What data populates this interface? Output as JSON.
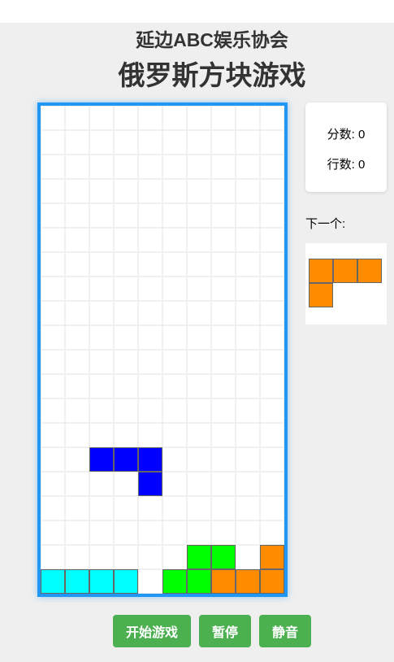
{
  "header": {
    "subtitle": "延边ABC娱乐协会",
    "title": "俄罗斯方块游戏"
  },
  "stats": {
    "score_label": "分数: 0",
    "lines_label": "行数: 0",
    "score": 0,
    "lines": 0
  },
  "next_piece": {
    "label": "下一个:",
    "type": "L",
    "color": "#ff8c00",
    "cells": [
      [
        0,
        0
      ],
      [
        1,
        0
      ],
      [
        2,
        0
      ],
      [
        0,
        1
      ]
    ]
  },
  "board": {
    "columns": 10,
    "rows": 20,
    "active_piece": {
      "type": "J",
      "color": "#0000ff",
      "cells": [
        [
          2,
          14
        ],
        [
          3,
          14
        ],
        [
          4,
          14
        ],
        [
          4,
          15
        ]
      ]
    },
    "settled_blocks": [
      {
        "col": 6,
        "row": 18,
        "color": "#00ff00"
      },
      {
        "col": 7,
        "row": 18,
        "color": "#00ff00"
      },
      {
        "col": 9,
        "row": 18,
        "color": "#ff8c00"
      },
      {
        "col": 0,
        "row": 19,
        "color": "#00ffff"
      },
      {
        "col": 1,
        "row": 19,
        "color": "#00ffff"
      },
      {
        "col": 2,
        "row": 19,
        "color": "#00ffff"
      },
      {
        "col": 3,
        "row": 19,
        "color": "#00ffff"
      },
      {
        "col": 5,
        "row": 19,
        "color": "#00ff00"
      },
      {
        "col": 6,
        "row": 19,
        "color": "#00ff00"
      },
      {
        "col": 7,
        "row": 19,
        "color": "#ff8c00"
      },
      {
        "col": 8,
        "row": 19,
        "color": "#ff8c00"
      },
      {
        "col": 9,
        "row": 19,
        "color": "#ff8c00"
      }
    ]
  },
  "controls": {
    "start_label": "开始游戏",
    "pause_label": "暂停",
    "mute_label": "静音"
  },
  "colors": {
    "board_border": "#2196f3",
    "button": "#4caf50",
    "background": "#efefef",
    "grid_line": "#f0f0f0"
  }
}
